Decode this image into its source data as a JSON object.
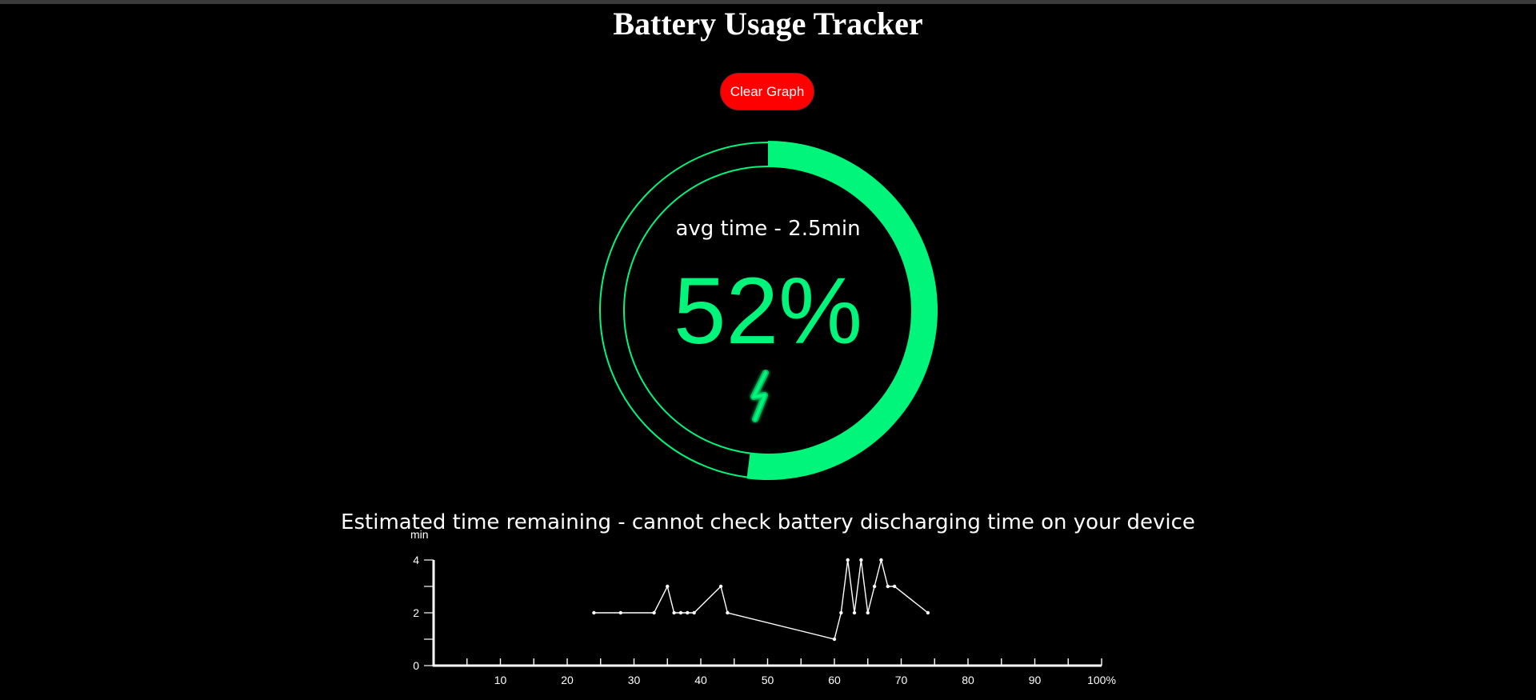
{
  "header": {
    "title": "Battery Usage Tracker"
  },
  "controls": {
    "clear_label": "Clear Graph"
  },
  "battery": {
    "avg_time_text": "avg time - 2.5min",
    "level_text": "52%",
    "level_fraction": 0.52,
    "charging": true,
    "icon": "lightning-bolt-icon"
  },
  "estimate": {
    "text": "Estimated time remaining - cannot check battery discharging time on your device"
  },
  "colors": {
    "accent": "#00f57a",
    "clear_button": "#ff0000",
    "background": "#000000",
    "text": "#ffffff"
  },
  "chart_data": {
    "type": "line",
    "ylabel": "min",
    "xlim": [
      0,
      100
    ],
    "ylim": [
      0,
      4
    ],
    "x_tick_labels": [
      "10",
      "20",
      "30",
      "40",
      "50",
      "60",
      "70",
      "80",
      "90",
      "100%"
    ],
    "x_ticks": [
      10,
      20,
      30,
      40,
      50,
      60,
      70,
      80,
      90,
      100
    ],
    "y_tick_labels": [
      "0",
      "2",
      "4"
    ],
    "y_ticks": [
      0,
      2,
      4
    ],
    "grid": false,
    "series": [
      {
        "x": [
          24,
          28,
          33,
          35,
          36,
          37,
          38,
          39,
          43,
          44,
          60,
          61,
          62,
          63,
          64,
          65,
          66,
          67,
          68,
          69,
          74
        ],
        "y": [
          2,
          2,
          2,
          3,
          2,
          2,
          2,
          2,
          3,
          2,
          1,
          2,
          4,
          2,
          4,
          2,
          3,
          4,
          3,
          3,
          2
        ]
      }
    ]
  }
}
